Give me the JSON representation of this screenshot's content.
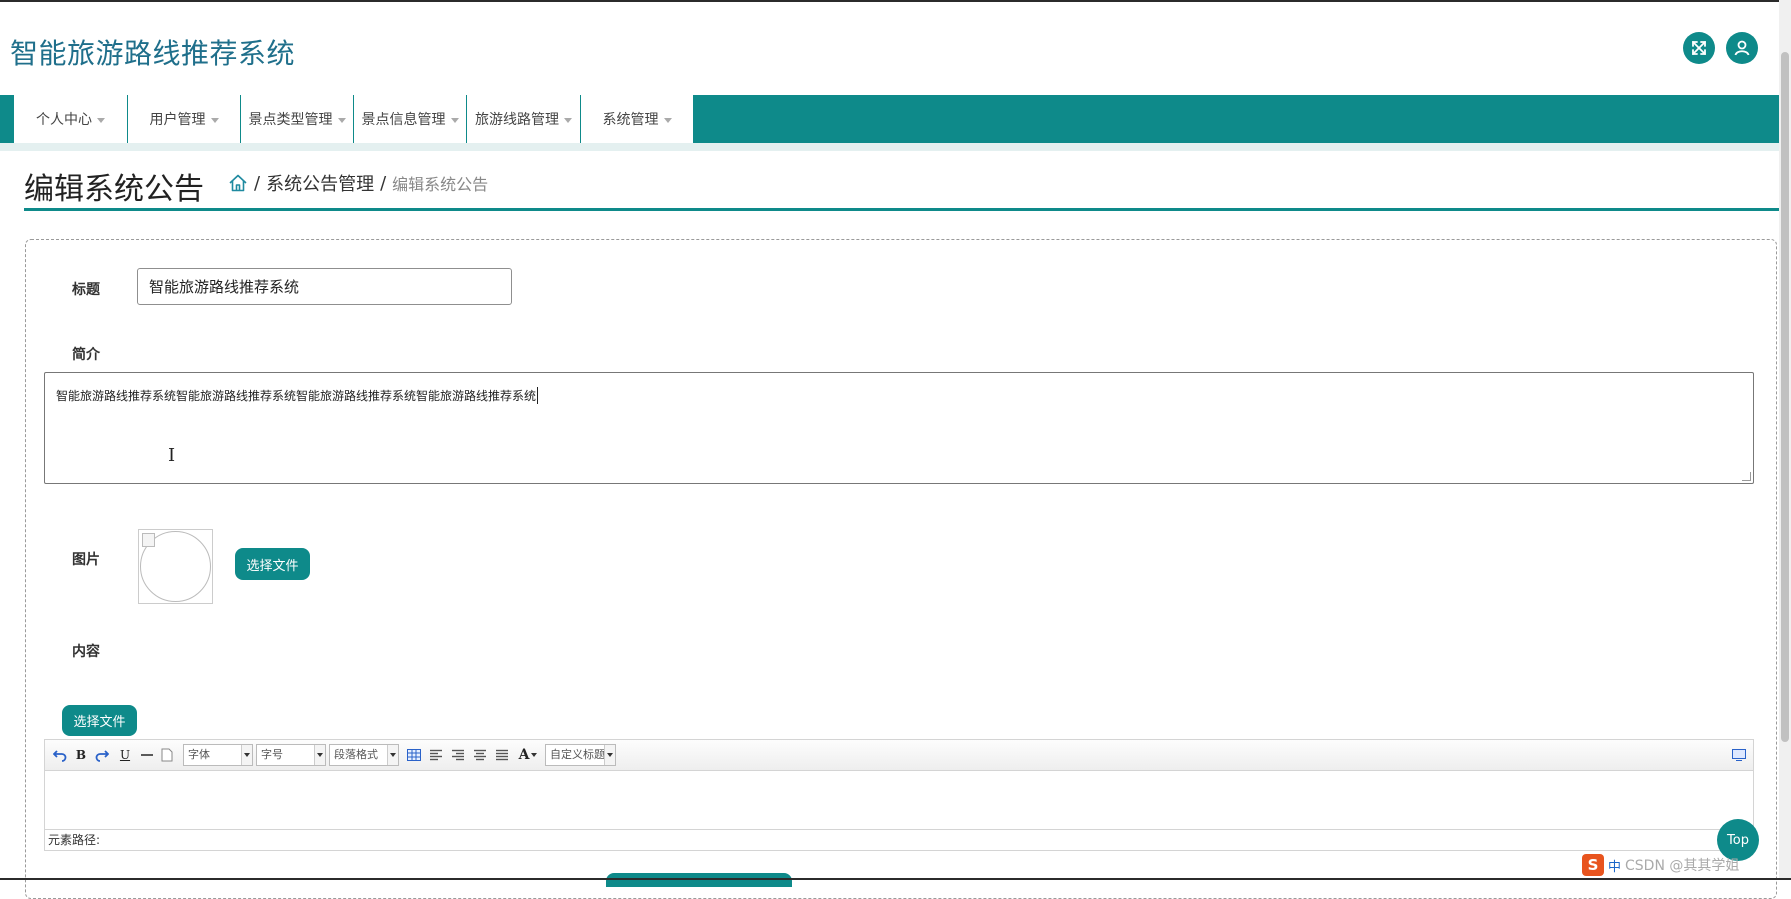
{
  "app": {
    "title": "智能旅游路线推荐系统"
  },
  "header": {
    "fullscreen_icon": "expand-arrows-icon",
    "user_icon": "user-icon"
  },
  "nav": {
    "items": [
      {
        "label": "个人中心"
      },
      {
        "label": "用户管理"
      },
      {
        "label": "景点类型管理"
      },
      {
        "label": "景点信息管理"
      },
      {
        "label": "旅游线路管理"
      },
      {
        "label": "系统管理"
      }
    ]
  },
  "page": {
    "title": "编辑系统公告",
    "breadcrumb": {
      "home_icon": "home-icon",
      "sep": "/",
      "level1": "系统公告管理",
      "current": "编辑系统公告"
    }
  },
  "form": {
    "title_label": "标题",
    "title_value": "智能旅游路线推荐系统",
    "summary_label": "简介",
    "summary_value": "智能旅游路线推荐系统智能旅游路线推荐系统智能旅游路线推荐系统智能旅游路线推荐系统",
    "image_label": "图片",
    "choose_file_label": "选择文件",
    "content_label": "内容",
    "content_choose_file_label": "选择文件"
  },
  "editor": {
    "toolbar": {
      "undo_icon": "undo-icon",
      "bold": "B",
      "redo_icon": "redo-icon",
      "underline": "U",
      "horizontal_rule_icon": "horizontal-rule-icon",
      "page_icon": "blank-page-icon",
      "font_family": "字体",
      "font_size": "字号",
      "paragraph": "段落格式",
      "table_icon": "table-icon",
      "align_left_icon": "align-left-icon",
      "align_right_icon": "align-right-icon",
      "align_center_icon": "align-center-icon",
      "align_justify_icon": "align-justify-icon",
      "font_color": "A",
      "custom_heading": "自定义标题",
      "source_icon": "fullscreen-editor-icon"
    },
    "status_label": "元素路径:"
  },
  "widgets": {
    "top_button": "Top",
    "ime_logo": "S",
    "ime_mode": "中",
    "watermark": "CSDN @其其学姐"
  },
  "colors": {
    "accent": "#0e8a8a",
    "title_blue": "#1f6f8b"
  }
}
